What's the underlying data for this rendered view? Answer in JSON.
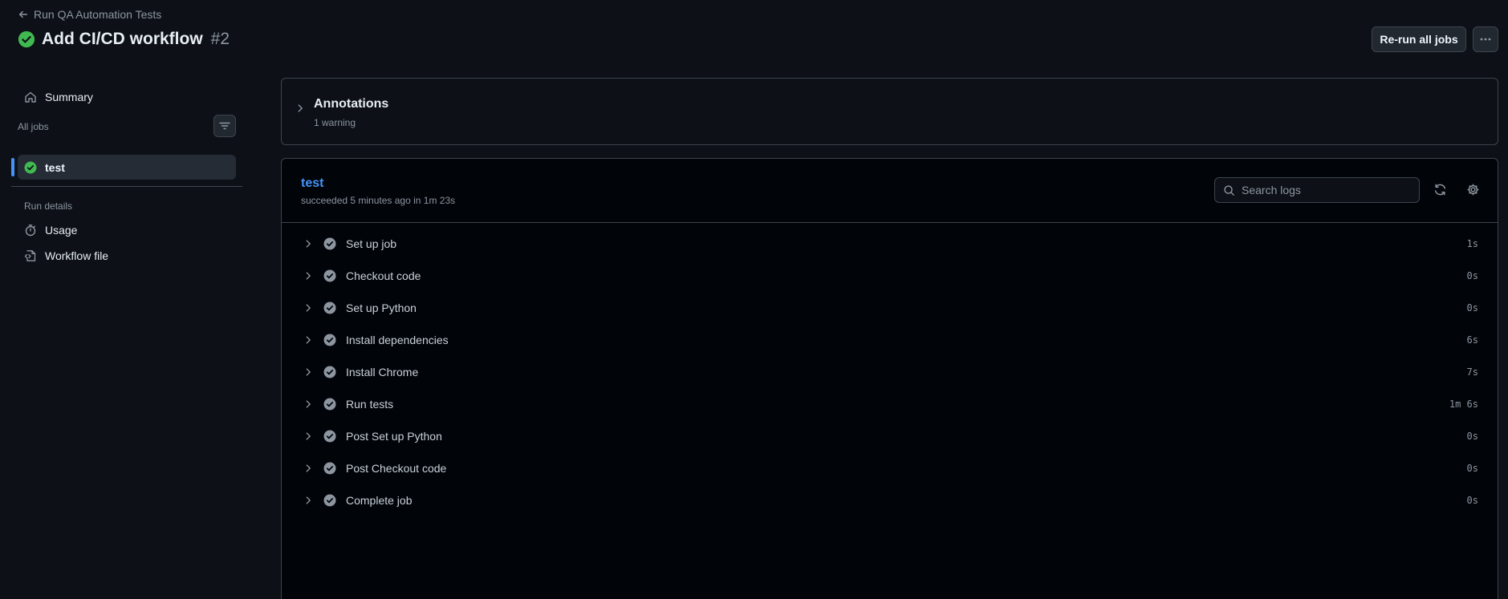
{
  "header": {
    "back_label": "Run QA Automation Tests",
    "title": "Add CI/CD workflow",
    "run_number": "#2",
    "rerun_label": "Re-run all jobs",
    "more_label": "···"
  },
  "sidebar": {
    "summary_label": "Summary",
    "all_jobs_label": "All jobs",
    "jobs": [
      {
        "label": "test",
        "status": "success"
      }
    ],
    "run_details_label": "Run details",
    "details_items": [
      {
        "label": "Usage",
        "icon": "stopwatch-icon"
      },
      {
        "label": "Workflow file",
        "icon": "file-code-icon"
      }
    ]
  },
  "annotations": {
    "title": "Annotations",
    "subtitle": "1 warning"
  },
  "job": {
    "name": "test",
    "status_text": "succeeded 5 minutes ago in 1m 23s",
    "search_placeholder": "Search logs",
    "steps": [
      {
        "name": "Set up job",
        "duration": "1s"
      },
      {
        "name": "Checkout code",
        "duration": "0s"
      },
      {
        "name": "Set up Python",
        "duration": "0s"
      },
      {
        "name": "Install dependencies",
        "duration": "6s"
      },
      {
        "name": "Install Chrome",
        "duration": "7s"
      },
      {
        "name": "Run tests",
        "duration": "1m 6s"
      },
      {
        "name": "Post Set up Python",
        "duration": "0s"
      },
      {
        "name": "Post Checkout code",
        "duration": "0s"
      },
      {
        "name": "Complete job",
        "duration": "0s"
      }
    ]
  },
  "colors": {
    "background": "#0d1117",
    "panel": "#010409",
    "success": "#3fb950",
    "accent": "#4493f8",
    "muted": "#8d96a0",
    "border": "#3d444d"
  }
}
